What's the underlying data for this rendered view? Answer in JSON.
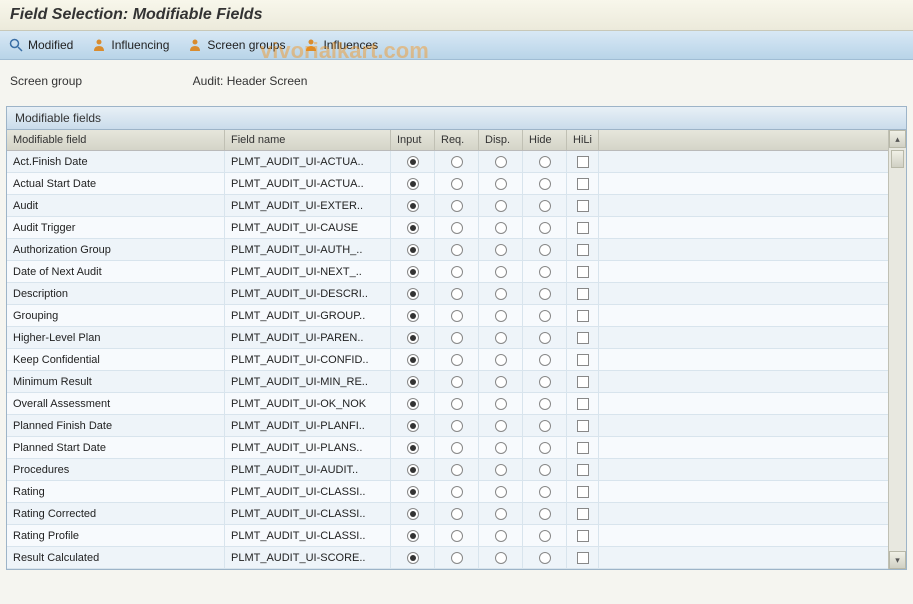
{
  "title": "Field Selection: Modifiable Fields",
  "toolbar": {
    "modified": "Modified",
    "influencing": "Influencing",
    "screen_groups": "Screen groups",
    "influences": "Influences"
  },
  "screen_group": {
    "label": "Screen group",
    "value": "Audit: Header Screen"
  },
  "panel_title": "Modifiable fields",
  "columns": {
    "field": "Modifiable field",
    "name": "Field name",
    "input": "Input",
    "req": "Req.",
    "disp": "Disp.",
    "hide": "Hide",
    "hili": "HiLi"
  },
  "rows": [
    {
      "field": "Act.Finish Date",
      "name": "PLMT_AUDIT_UI-ACTUA..",
      "selected": "input"
    },
    {
      "field": "Actual Start Date",
      "name": "PLMT_AUDIT_UI-ACTUA..",
      "selected": "input"
    },
    {
      "field": "Audit",
      "name": "PLMT_AUDIT_UI-EXTER..",
      "selected": "input"
    },
    {
      "field": "Audit Trigger",
      "name": "PLMT_AUDIT_UI-CAUSE",
      "selected": "input"
    },
    {
      "field": "Authorization Group",
      "name": "PLMT_AUDIT_UI-AUTH_..",
      "selected": "input"
    },
    {
      "field": "Date of Next Audit",
      "name": "PLMT_AUDIT_UI-NEXT_..",
      "selected": "input"
    },
    {
      "field": "Description",
      "name": "PLMT_AUDIT_UI-DESCRI..",
      "selected": "input"
    },
    {
      "field": "Grouping",
      "name": "PLMT_AUDIT_UI-GROUP..",
      "selected": "input"
    },
    {
      "field": "Higher-Level Plan",
      "name": "PLMT_AUDIT_UI-PAREN..",
      "selected": "input"
    },
    {
      "field": "Keep Confidential",
      "name": "PLMT_AUDIT_UI-CONFID..",
      "selected": "input"
    },
    {
      "field": "Minimum Result",
      "name": "PLMT_AUDIT_UI-MIN_RE..",
      "selected": "input"
    },
    {
      "field": "Overall Assessment",
      "name": "PLMT_AUDIT_UI-OK_NOK",
      "selected": "input"
    },
    {
      "field": "Planned Finish Date",
      "name": "PLMT_AUDIT_UI-PLANFI..",
      "selected": "input"
    },
    {
      "field": "Planned Start Date",
      "name": "PLMT_AUDIT_UI-PLANS..",
      "selected": "input"
    },
    {
      "field": "Procedures",
      "name": "PLMT_AUDIT_UI-AUDIT..",
      "selected": "input"
    },
    {
      "field": "Rating",
      "name": "PLMT_AUDIT_UI-CLASSI..",
      "selected": "input"
    },
    {
      "field": "Rating Corrected",
      "name": "PLMT_AUDIT_UI-CLASSI..",
      "selected": "input"
    },
    {
      "field": "Rating Profile",
      "name": "PLMT_AUDIT_UI-CLASSI..",
      "selected": "input"
    },
    {
      "field": "Result Calculated",
      "name": "PLMT_AUDIT_UI-SCORE..",
      "selected": "input"
    }
  ],
  "watermark": "vivorialkart.com"
}
